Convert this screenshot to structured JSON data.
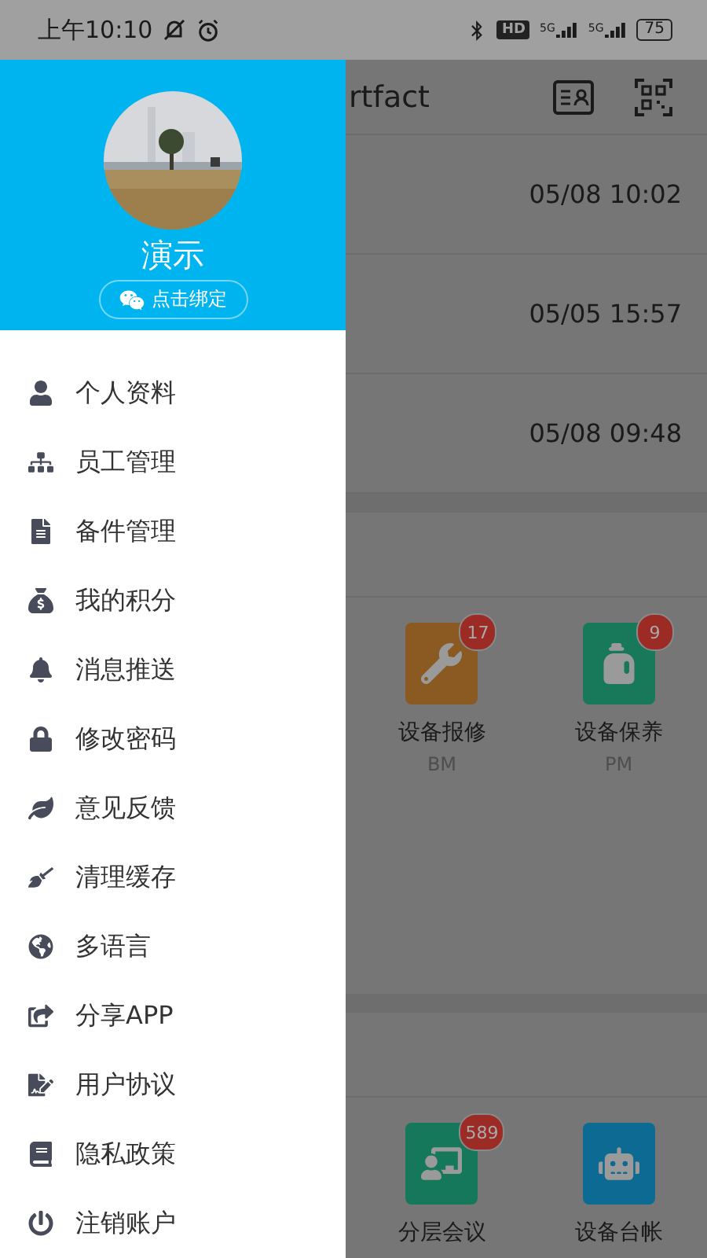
{
  "status_bar": {
    "time": "上午10:10",
    "hd_label": "HD",
    "network_labels": [
      "5G",
      "5G"
    ],
    "battery": "75"
  },
  "app_header": {
    "title": "rtfact"
  },
  "records": [
    {
      "time": "05/08 10:02"
    },
    {
      "time": "05/05 15:57"
    },
    {
      "time": "05/08 09:48"
    }
  ],
  "sections": [
    {
      "tiles": [
        {
          "label": "设备报修",
          "sublabel": "BM",
          "badge": "17",
          "color": "#8a5a22"
        },
        {
          "label": "设备保养",
          "sublabel": "PM",
          "badge": "9",
          "color": "#17785a"
        }
      ]
    },
    {
      "tiles": [
        {
          "label": "分层会议",
          "badge": "589",
          "color": "#16785a"
        },
        {
          "label": "设备台帐",
          "color": "#0d6a92"
        }
      ]
    }
  ],
  "drawer": {
    "profile": {
      "name": "演示",
      "bind_button": "点击绑定"
    },
    "menu": [
      {
        "label": "个人资料"
      },
      {
        "label": "员工管理"
      },
      {
        "label": "备件管理"
      },
      {
        "label": "我的积分"
      },
      {
        "label": "消息推送"
      },
      {
        "label": "修改密码"
      },
      {
        "label": "意见反馈"
      },
      {
        "label": "清理缓存"
      },
      {
        "label": "多语言"
      },
      {
        "label": "分享APP"
      },
      {
        "label": "用户协议"
      },
      {
        "label": "隐私政策"
      },
      {
        "label": "注销账户"
      }
    ]
  }
}
